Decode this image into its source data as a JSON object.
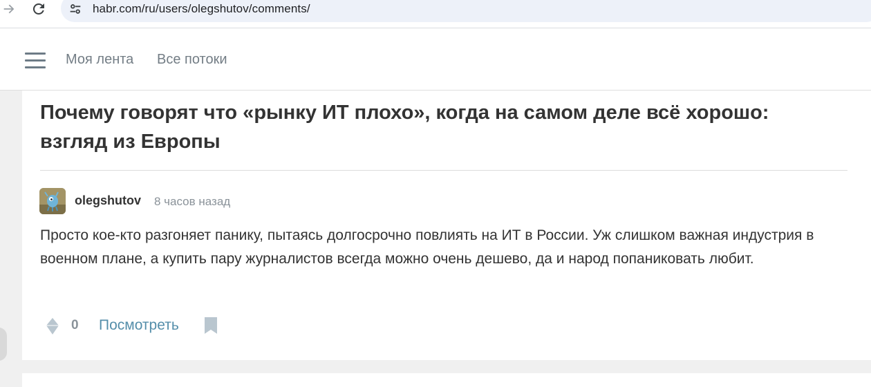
{
  "browser": {
    "url": "habr.com/ru/users/olegshutov/comments/"
  },
  "header": {
    "nav": [
      "Моя лента",
      "Все потоки"
    ]
  },
  "post": {
    "title": "Почему говорят что «рынку ИТ плохо», когда на самом деле всё хорошо: взгляд из Европы"
  },
  "comment": {
    "author": "olegshutov",
    "time": "8 часов назад",
    "text": "Просто кое-кто разгоняет панику, пытаясь долгосрочно повлиять на ИТ в России. Уж слишком важная индустрия в военном плане, а купить пару журналистов всегда можно очень дешево, да и народ попаниковать любит.",
    "votes": "0",
    "view_label": "Посмотреть"
  },
  "colors": {
    "accent_link": "#548eaa",
    "icon_gray": "#b9c6cf"
  }
}
